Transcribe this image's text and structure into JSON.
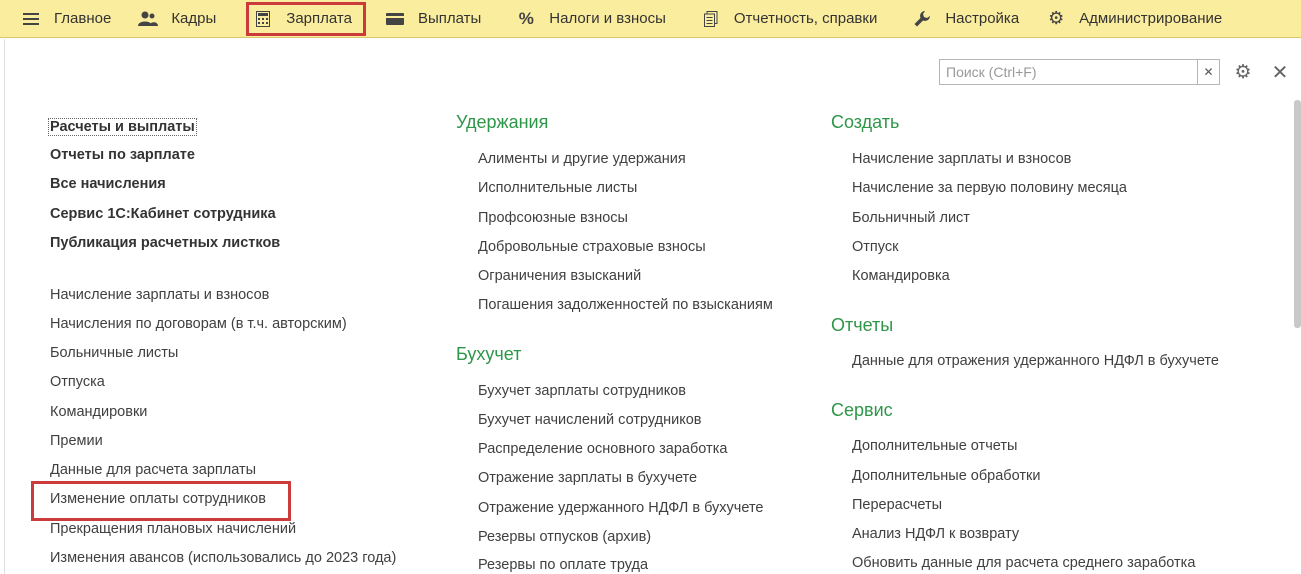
{
  "menu": [
    {
      "label": "Главное",
      "icon": "hamburger-icon"
    },
    {
      "label": "Кадры",
      "icon": "people-icon"
    },
    {
      "label": "Зарплата",
      "icon": "calculator-icon"
    },
    {
      "label": "Выплаты",
      "icon": "wallet-icon"
    },
    {
      "label": "Налоги и взносы",
      "icon": "percent-icon"
    },
    {
      "label": "Отчетность, справки",
      "icon": "documents-icon"
    },
    {
      "label": "Настройка",
      "icon": "wrench-icon"
    },
    {
      "label": "Администрирование",
      "icon": "gear-icon"
    }
  ],
  "search": {
    "placeholder": "Поиск (Ctrl+F)"
  },
  "left": {
    "bold": [
      "Расчеты и выплаты",
      "Отчеты по зарплате",
      "Все начисления",
      "Сервис 1С:Кабинет сотрудника",
      "Публикация расчетных листков"
    ],
    "items": [
      "Начисление зарплаты и взносов",
      "Начисления по договорам (в т.ч. авторским)",
      "Больничные листы",
      "Отпуска",
      "Командировки",
      "Премии",
      "Данные для расчета зарплаты",
      "Изменение оплаты сотрудников",
      "Прекращения плановых начислений",
      "Изменения авансов (использовались до 2023 года)"
    ]
  },
  "middle": {
    "sections": [
      {
        "title": "Удержания",
        "items": [
          "Алименты и другие удержания",
          "Исполнительные листы",
          "Профсоюзные взносы",
          "Добровольные страховые взносы",
          "Ограничения взысканий",
          "Погашения задолженностей по взысканиям"
        ]
      },
      {
        "title": "Бухучет",
        "items": [
          "Бухучет зарплаты сотрудников",
          "Бухучет начислений сотрудников",
          "Распределение основного заработка",
          "Отражение зарплаты в бухучете",
          "Отражение удержанного НДФЛ в бухучете",
          "Резервы отпусков (архив)",
          "Резервы по оплате труда"
        ]
      }
    ]
  },
  "right": {
    "sections": [
      {
        "title": "Создать",
        "items": [
          "Начисление зарплаты и взносов",
          "Начисление за первую половину месяца",
          "Больничный лист",
          "Отпуск",
          "Командировка"
        ]
      },
      {
        "title": "Отчеты",
        "items": [
          "Данные для отражения удержанного НДФЛ в бухучете"
        ]
      },
      {
        "title": "Сервис",
        "items": [
          "Дополнительные отчеты",
          "Дополнительные обработки",
          "Перерасчеты",
          "Анализ НДФЛ к возврату",
          "Обновить данные для расчета среднего заработка"
        ]
      }
    ]
  }
}
